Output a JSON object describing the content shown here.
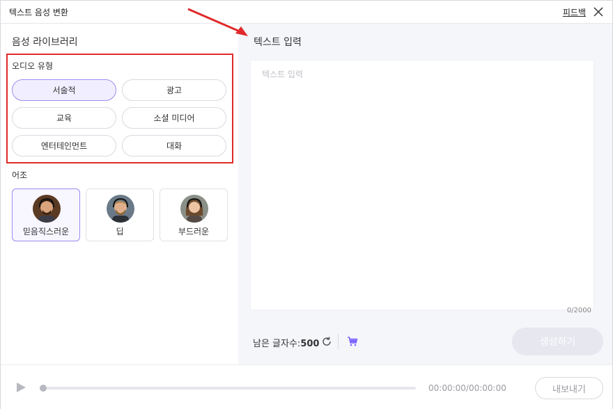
{
  "header": {
    "title": "텍스트 음성 변환",
    "feedback": "피드백"
  },
  "left": {
    "library_title": "음성 라이브러리",
    "audio_type_label": "오디오 유형",
    "audio_types": [
      "서술적",
      "광고",
      "교육",
      "소셜 미디어",
      "엔터테인먼트",
      "대화"
    ],
    "selected_audio_type": "서술적",
    "tone_label": "어조",
    "tones": [
      "믿음직스러운",
      "딥",
      "부드러운"
    ],
    "selected_tone": "믿음직스러운"
  },
  "right": {
    "title": "텍스트 입력",
    "text_placeholder": "텍스트 입력",
    "text_value": "",
    "char_counter": "0/2000",
    "remaining_label": "남은 글자수:",
    "remaining_value": "500",
    "generate_label": "생성하기"
  },
  "player": {
    "time": "00:00:00/00:00:00",
    "progress": 0,
    "export_label": "내보내기"
  },
  "colors": {
    "accent": "#7b61ff",
    "highlight_box": "#e02a2a",
    "annotation_arrow": "#e02a2a"
  }
}
